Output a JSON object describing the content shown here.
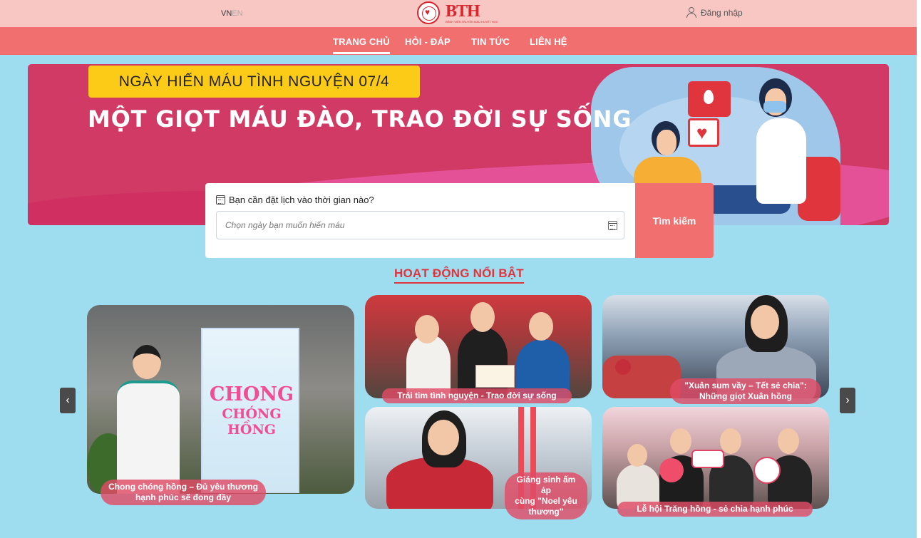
{
  "header": {
    "lang_vn": "VN",
    "lang_en": "EN",
    "logo_text": "BTH",
    "logo_sub": "BỆNH VIỆN TRUYỀN MÁU HUYẾT HỌC",
    "login_label": "Đăng nhập"
  },
  "nav": {
    "items": [
      {
        "label": "TRANG CHỦ",
        "active": true
      },
      {
        "label": "HỎI - ĐÁP"
      },
      {
        "label": "TIN TỨC"
      },
      {
        "label": "LIÊN HỆ"
      }
    ]
  },
  "hero": {
    "badge": "NGÀY HIẾN MÁU TÌNH NGUYỆN 07/4",
    "headline": "MỘT GIỌT MÁU ĐÀO, TRAO ĐỜI SỰ SỐNG"
  },
  "search": {
    "label": "Bạn cần đặt lịch vào thời gian nào?",
    "placeholder": "Chọn ngày bạn muốn hiến máu",
    "button": "Tìm kiếm"
  },
  "section": {
    "title": "HOẠT ĐỘNG NỔI BẬT"
  },
  "gallery": {
    "poster_line1": "CHONG",
    "poster_line2": "CHÓNG HỒNG",
    "cards": [
      {
        "caption": "Chong chóng hồng – Đủ yêu thương\nhạnh phúc sẽ đong đầy"
      },
      {
        "caption": "Trái tim tình nguyện - Trao đời sự sống"
      },
      {
        "caption": "\"Xuân sum vầy – Tết sẻ chia\":\nNhững giọt Xuân hồng"
      },
      {
        "caption": "Giáng sinh ấm áp\ncùng \"Noel yêu\nthương\""
      },
      {
        "caption": "Lễ hội Trăng hồng - sẻ chia hạnh phúc"
      }
    ],
    "prev": "‹",
    "next": "›"
  },
  "colors": {
    "topbar": "#f8c7c3",
    "nav": "#f16f6f",
    "background": "#9edcef",
    "accent": "#e0353c",
    "badge": "#fccb18",
    "hero": "#d23a66"
  }
}
